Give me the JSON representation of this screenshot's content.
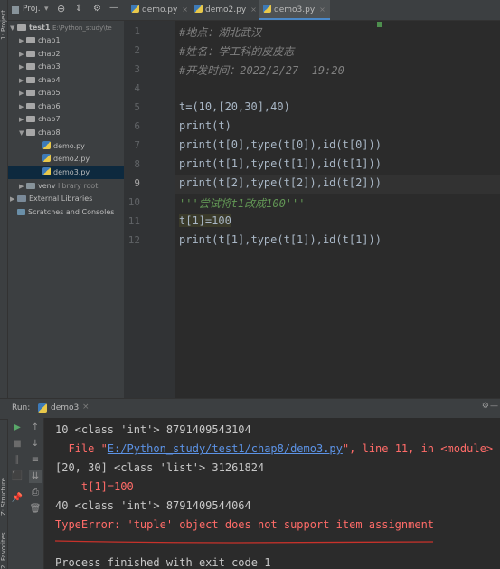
{
  "left_strip": {
    "project_tab": "1: Project",
    "structure_tab": "Z: Structure",
    "favorites_tab": "2: Favorites"
  },
  "project_panel": {
    "title": "Proj.",
    "tree": [
      {
        "label": "test1",
        "extra": "E:\\Python_study\\te",
        "type": "root",
        "expanded": true
      },
      {
        "label": "chap1",
        "type": "folder"
      },
      {
        "label": "chap2",
        "type": "folder"
      },
      {
        "label": "chap3",
        "type": "folder"
      },
      {
        "label": "chap4",
        "type": "folder"
      },
      {
        "label": "chap5",
        "type": "folder"
      },
      {
        "label": "chap6",
        "type": "folder"
      },
      {
        "label": "chap7",
        "type": "folder"
      },
      {
        "label": "chap8",
        "type": "folder",
        "expanded": true
      },
      {
        "label": "demo.py",
        "type": "file"
      },
      {
        "label": "demo2.py",
        "type": "file"
      },
      {
        "label": "demo3.py",
        "type": "file",
        "selected": true
      },
      {
        "label": "venv",
        "extra": "library root",
        "type": "folder"
      },
      {
        "label": "External Libraries",
        "type": "lib"
      },
      {
        "label": "Scratches and Consoles",
        "type": "scratch"
      }
    ]
  },
  "tabs": [
    {
      "label": "demo.py",
      "active": false
    },
    {
      "label": "demo2.py",
      "active": false
    },
    {
      "label": "demo3.py",
      "active": true
    }
  ],
  "editor": {
    "line_numbers": [
      "1",
      "2",
      "3",
      "4",
      "5",
      "6",
      "7",
      "8",
      "9",
      "10",
      "11",
      "12"
    ],
    "lines": [
      "#地点：湖北武汉",
      "#姓名：学工科的皮皮志",
      "#开发时间：2022/2/27  19:20",
      "",
      "t=(10,[20,30],40)",
      "print(t)",
      "print(t[0],type(t[0]),id(t[0]))",
      "print(t[1],type(t[1]),id(t[1]))",
      "print(t[2],type(t[2]),id(t[2]))",
      "'''尝试将t1改成100'''",
      "t[1]=100",
      "print(t[1],type(t[1]),id(t[1]))"
    ]
  },
  "run_panel": {
    "label": "Run:",
    "config": "demo3",
    "output": [
      {
        "text": "10 <class 'int'> 8791409543104",
        "kind": "normal"
      },
      {
        "prefix": "  File \"",
        "link": "E:/Python_study/test1/chap8/demo3.py",
        "suffix": "\", line 11, in <module>",
        "kind": "error-link"
      },
      {
        "text": "[20, 30] <class 'list'> 31261824",
        "kind": "normal"
      },
      {
        "text": "    t[1]=100",
        "kind": "error"
      },
      {
        "text": "40 <class 'int'> 8791409544064",
        "kind": "normal"
      },
      {
        "text": "TypeError: 'tuple' object does not support item assignment",
        "kind": "error"
      },
      {
        "text": "",
        "kind": "normal"
      },
      {
        "text": "Process finished with exit code 1",
        "kind": "normal"
      }
    ]
  },
  "colors": {
    "accent": "#4a88c7",
    "error": "#ff6b68",
    "comment": "#808080",
    "number": "#6897bb",
    "underline": "#c8322b"
  }
}
